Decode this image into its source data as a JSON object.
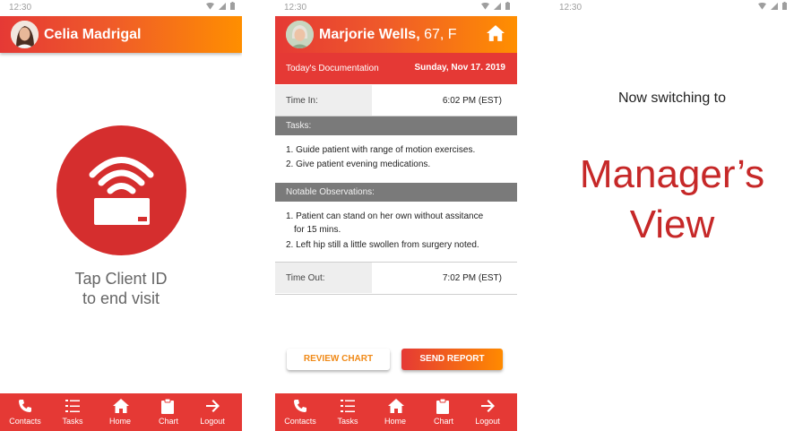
{
  "status_time": "12:30",
  "screen1": {
    "user_name": "Celia Madrigal",
    "tap_line1": "Tap Client ID",
    "tap_line2": "to end visit"
  },
  "screen2": {
    "client_name": "Marjorie Wells,",
    "client_age": " 67, F",
    "doc_label": "Today's Documentation",
    "doc_date": "Sunday, Nov 17. 2019",
    "time_in_label": "Time In:",
    "time_in_value": "6:02 PM (EST)",
    "tasks_header": "Tasks:",
    "tasks": [
      "1. Guide patient with range of motion exercises.",
      "2. Give patient evening medications."
    ],
    "observations_header": "Notable Observations:",
    "observations": [
      "1. Patient can stand on her own without assitance",
      "for 15 mins.",
      "2. Left hip still a little swollen from surgery noted."
    ],
    "time_out_label": "Time Out:",
    "time_out_value": "7:02 PM (EST)",
    "review_button": "REVIEW CHART",
    "send_button": "SEND REPORT"
  },
  "nav": [
    {
      "label": "Contacts",
      "icon": "phone-icon"
    },
    {
      "label": "Tasks",
      "icon": "list-icon"
    },
    {
      "label": "Home",
      "icon": "home-icon"
    },
    {
      "label": "Chart",
      "icon": "clipboard-icon"
    },
    {
      "label": "Logout",
      "icon": "arrow-right-icon"
    }
  ],
  "screen3": {
    "switch_text": "Now switching to",
    "title_line1": "Manager’s",
    "title_line2": "View"
  },
  "colors": {
    "primary_red": "#e53935",
    "accent_orange": "#ff8f00",
    "manager_red": "#c62828",
    "section_gray": "#7a7a7a"
  }
}
